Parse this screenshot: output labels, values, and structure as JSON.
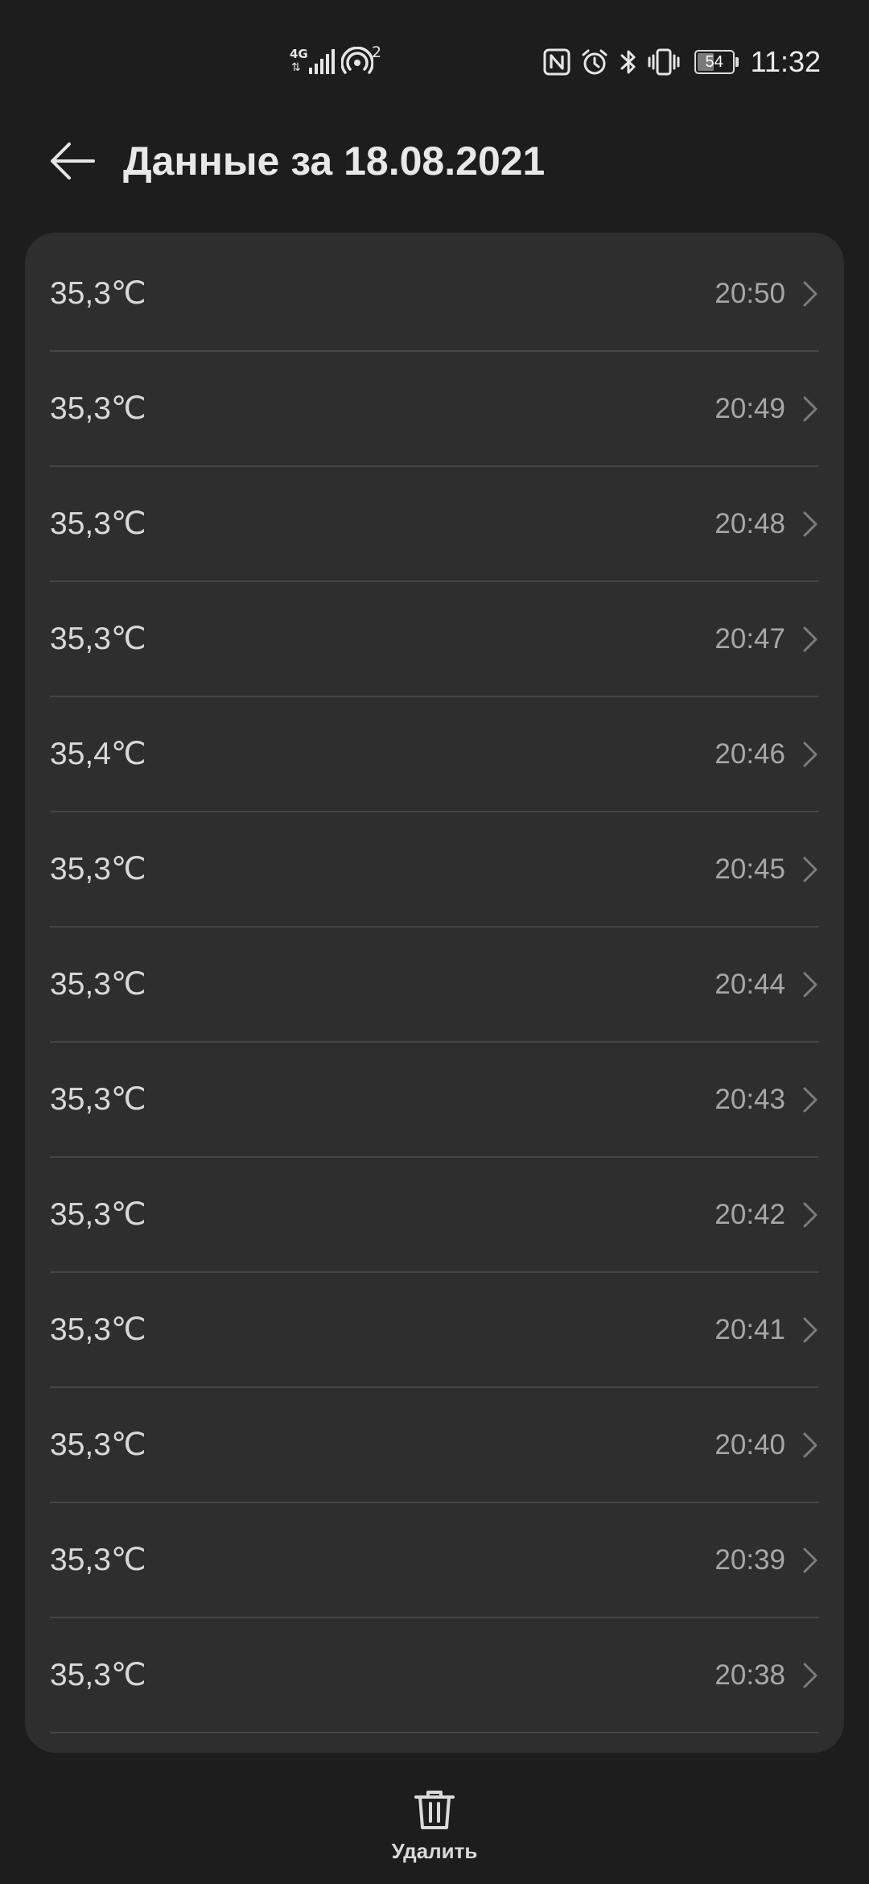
{
  "status_bar": {
    "network_type": "4G",
    "network_arrows": "⇅",
    "hotspot_connections": "2",
    "battery_percent": "54",
    "battery_level": 0.54,
    "time": "11:32",
    "icons": [
      "nfc-icon",
      "alarm-icon",
      "bluetooth-icon",
      "vibrate-icon"
    ]
  },
  "header": {
    "back_icon": "arrow-left-icon",
    "title": "Данные за 18.08.2021"
  },
  "measurements": [
    {
      "value": "35,3℃",
      "time": "20:50"
    },
    {
      "value": "35,3℃",
      "time": "20:49"
    },
    {
      "value": "35,3℃",
      "time": "20:48"
    },
    {
      "value": "35,3℃",
      "time": "20:47"
    },
    {
      "value": "35,4℃",
      "time": "20:46"
    },
    {
      "value": "35,3℃",
      "time": "20:45"
    },
    {
      "value": "35,3℃",
      "time": "20:44"
    },
    {
      "value": "35,3℃",
      "time": "20:43"
    },
    {
      "value": "35,3℃",
      "time": "20:42"
    },
    {
      "value": "35,3℃",
      "time": "20:41"
    },
    {
      "value": "35,3℃",
      "time": "20:40"
    },
    {
      "value": "35,3℃",
      "time": "20:39"
    },
    {
      "value": "35,3℃",
      "time": "20:38"
    }
  ],
  "bottom_bar": {
    "delete_label": "Удалить",
    "delete_icon": "trash-icon"
  },
  "colors": {
    "background": "#1d1d1d",
    "card": "#2e2e2e",
    "divider": "#454545",
    "primary_text": "#d8d8d8",
    "secondary_text": "#a7a7a7"
  }
}
